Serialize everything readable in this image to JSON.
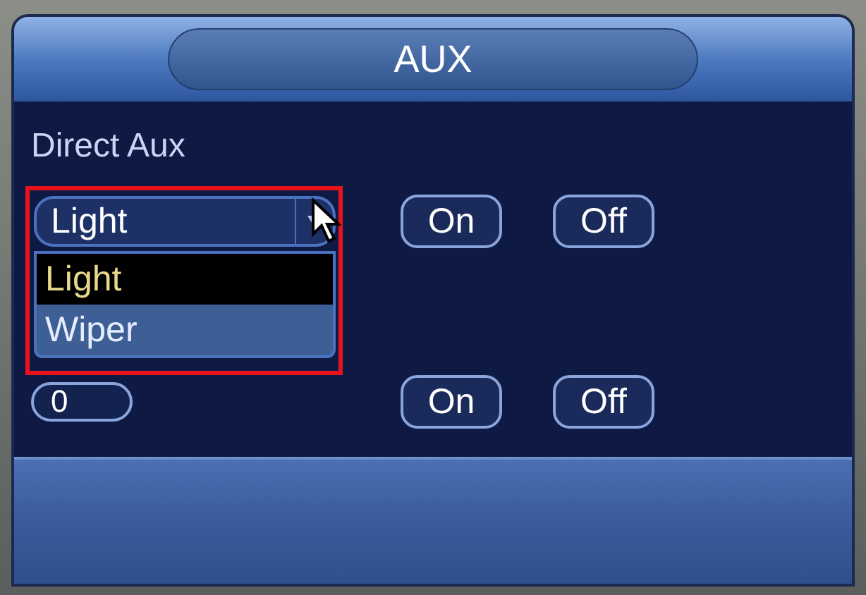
{
  "window": {
    "title": "AUX"
  },
  "section_label": "Direct Aux",
  "rows": [
    {
      "kind": "select",
      "value": "Light",
      "open": true,
      "highlighted": true,
      "options": [
        {
          "label": "Light",
          "selected": true
        },
        {
          "label": "Wiper",
          "selected": false
        }
      ],
      "buttons": [
        "On",
        "Off"
      ]
    },
    {
      "kind": "field",
      "value": "0",
      "buttons": [
        "On",
        "Off"
      ]
    }
  ]
}
